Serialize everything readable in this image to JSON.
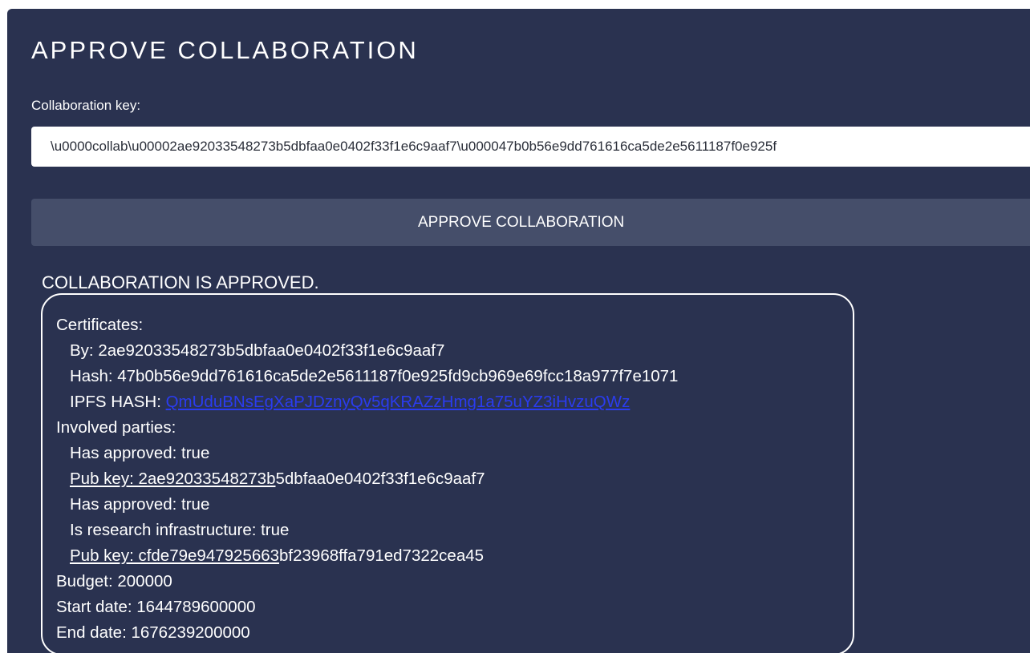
{
  "page": {
    "title": "APPROVE COLLABORATION"
  },
  "form": {
    "key_label": "Collaboration key:",
    "key_value": "\\u0000collab\\u00002ae92033548273b5dbfaa0e0402f33f1e6c9aaf7\\u000047b0b56e9dd761616ca5de2e5611187f0e925f",
    "approve_button_label": "APPROVE COLLABORATION"
  },
  "result": {
    "status": "COLLABORATION IS APPROVED.",
    "certificates_label": "Certificates:",
    "by": "By: 2ae92033548273b5dbfaa0e0402f33f1e6c9aaf7",
    "hash": "Hash: 47b0b56e9dd761616ca5de2e5611187f0e925fd9cb969e69fcc18a977f7e1071",
    "ipfs_label": "IPFS HASH: ",
    "ipfs_value": "QmUduBNsEgXaPJDznyQv5qKRAZzHmg1a75uYZ3iHvzuQWz",
    "involved_label": "Involved parties:",
    "parties": [
      {
        "has_approved": "Has approved: true",
        "pub_key_prefix": "Pub key: 2ae92033548273b",
        "pub_key_rest": "5dbfaa0e0402f33f1e6c9aaf7"
      },
      {
        "has_approved": "Has approved: true",
        "research_infra": "Is research infrastructure: true",
        "pub_key_prefix": "Pub key: cfde79e947925663",
        "pub_key_rest": "bf23968ffa791ed7322cea45"
      }
    ],
    "budget": "Budget: 200000",
    "start_date": "Start date: 1644789600000",
    "end_date": "End date: 1676239200000"
  },
  "colors": {
    "panel_bg": "#2a3250",
    "button_bg": "#454e6a",
    "link": "#2a3cf0",
    "text": "#ffffff"
  }
}
